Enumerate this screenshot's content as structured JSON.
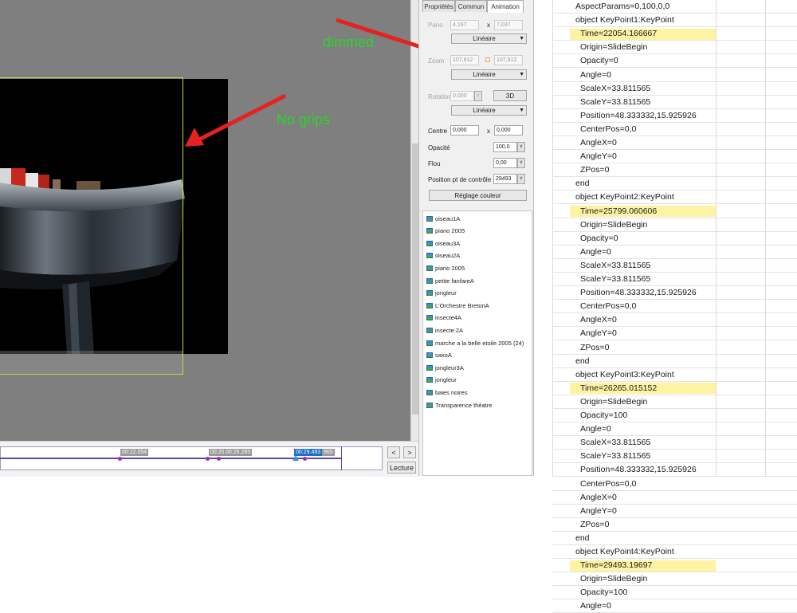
{
  "props_panel": {
    "tabs": [
      "Propriétés",
      "Commun",
      "Animation"
    ],
    "active_tab": 2,
    "pano": {
      "label": "Pano",
      "x": "4,167",
      "sep": "x",
      "y": "7,037",
      "interp": "Linéaire"
    },
    "zoom": {
      "label": "Zoom",
      "x": "107,812",
      "y": "107,812",
      "interp": "Linéaire"
    },
    "rotation": {
      "label": "Rotation",
      "value": "0,000",
      "btn_3d": "3D",
      "interp": "Linéaire"
    },
    "centre": {
      "label": "Centre",
      "x": "0,000",
      "sep": "x",
      "y": "0,000"
    },
    "opacite": {
      "label": "Opacité",
      "value": "100,0"
    },
    "flou": {
      "label": "Flou",
      "value": "0,00"
    },
    "position": {
      "label": "Position pt de contrôle",
      "value": "29493"
    },
    "color_btn": "Réglage couleur"
  },
  "slides": [
    "oiseau1A",
    "piano 2005",
    "oiseau3A",
    "oiseau2A",
    "piano 2005",
    "petite fanfareA",
    "jongleur",
    "L'Orchestre  BretonA",
    "insecte4A",
    "insecte 2A",
    "marche a la belle etoile 2005 (24)",
    "saxoA",
    "jongleur3A",
    "jongleur",
    "baies noires",
    "Transparence théatre"
  ],
  "timeline": {
    "tags": [
      "00:22.054",
      "00:26.265",
      "00:29.493"
    ],
    "tag_partial_left": "00:20",
    "tag_partial_right": "965",
    "prev": "<",
    "next": ">",
    "play": "Lecture"
  },
  "sheet_lines": [
    "AspectParams=0,100,0,0",
    "object KeyPoint1:KeyPoint",
    "  Time=22054.166667",
    "  Origin=SlideBegin",
    "  Opacity=0",
    "  Angle=0",
    "  ScaleX=33.811565",
    "  ScaleY=33.811565",
    "  Position=48.333332,15.925926",
    "  CenterPos=0,0",
    "  AngleX=0",
    "  AngleY=0",
    "  ZPos=0",
    "end",
    "object KeyPoint2:KeyPoint",
    "  Time=25799.060606",
    "  Origin=SlideBegin",
    "  Opacity=0",
    "  Angle=0",
    "  ScaleX=33.811565",
    "  ScaleY=33.811565",
    "  Position=48.333332,15.925926",
    "  CenterPos=0,0",
    "  AngleX=0",
    "  AngleY=0",
    "  ZPos=0",
    "end",
    "object KeyPoint3:KeyPoint",
    "  Time=26265.015152",
    "  Origin=SlideBegin",
    "  Opacity=100",
    "  Angle=0",
    "  ScaleX=33.811565",
    "  ScaleY=33.811565",
    "  Position=48.333332,15.925926",
    "  CenterPos=0,0",
    "  AngleX=0",
    "  AngleY=0",
    "  ZPos=0",
    "end",
    "object KeyPoint4:KeyPoint",
    "  Time=29493.19697",
    "  Origin=SlideBegin",
    "  Opacity=100",
    "  Angle=0"
  ],
  "highlighted_rows": [
    2,
    15,
    28,
    41
  ],
  "annotations": {
    "dimmed": "dimmed",
    "no_grips": "No grips"
  },
  "colors": {
    "annotation_text": "#2bd42b",
    "arrow": "#e52222",
    "highlight": "#fdf3a3",
    "frame_outline": "#c8d63c"
  }
}
